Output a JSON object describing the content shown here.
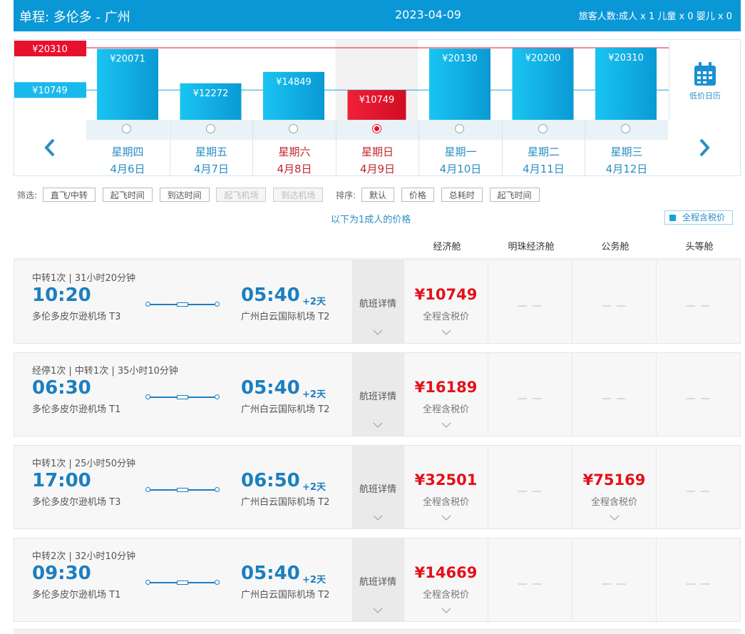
{
  "header": {
    "route": "单程:  多伦多  -  广州",
    "date": "2023-04-09",
    "passengers": "旅客人数:成人 x 1   儿童 x 0   婴儿 x 0"
  },
  "price_chart": {
    "max_label": "¥20310",
    "min_label": "¥10749",
    "max_value": 20310,
    "min_value": 10749,
    "calendar_label": "低价日历",
    "calendar_icon": "calendar-icon",
    "prev_icon": "chevron-left-icon",
    "next_icon": "chevron-right-icon",
    "days": [
      {
        "price": "¥20071",
        "value": 20071,
        "weekday": "星期四",
        "date": "4月6日",
        "weekend": false,
        "selected": false
      },
      {
        "price": "¥12272",
        "value": 12272,
        "weekday": "星期五",
        "date": "4月7日",
        "weekend": false,
        "selected": false
      },
      {
        "price": "¥14849",
        "value": 14849,
        "weekday": "星期六",
        "date": "4月8日",
        "weekend": true,
        "selected": false
      },
      {
        "price": "¥10749",
        "value": 10749,
        "weekday": "星期日",
        "date": "4月9日",
        "weekend": true,
        "selected": true
      },
      {
        "price": "¥20130",
        "value": 20130,
        "weekday": "星期一",
        "date": "4月10日",
        "weekend": false,
        "selected": false
      },
      {
        "price": "¥20200",
        "value": 20200,
        "weekday": "星期二",
        "date": "4月11日",
        "weekend": false,
        "selected": false
      },
      {
        "price": "¥20310",
        "value": 20310,
        "weekday": "星期三",
        "date": "4月12日",
        "weekend": false,
        "selected": false
      }
    ],
    "colors": {
      "bar": "#0fb7ea",
      "selected": "#e8112d",
      "max_line": "#e8112d",
      "min_line": "#1fa3d9"
    }
  },
  "filters": {
    "filter_label": "筛选:",
    "filter_buttons": [
      "直飞/中转",
      "起飞时间",
      "到达时间",
      "起飞机场",
      "到达机场"
    ],
    "sort_label": "排序:",
    "sort_buttons": [
      "默认",
      "价格",
      "总耗时",
      "起飞时间"
    ]
  },
  "price_note": "以下为1成人的价格",
  "tax_toggle": "全程含税价",
  "cabins": [
    "经济舱",
    "明珠经济舱",
    "公务舱",
    "头等舱"
  ],
  "flights": [
    {
      "meta": "中转1次 | 31小时20分钟",
      "dep_time": "10:20",
      "dep_airport": "多伦多皮尔逊机场 T3",
      "arr_time": "05:40",
      "plus_days": "+2天",
      "arr_airport": "广州白云国际机场 T2",
      "detail": "航班详情",
      "fares": [
        {
          "price": "¥10749",
          "tax": "全程含税价"
        },
        {
          "price": "",
          "tax": ""
        },
        {
          "price": "",
          "tax": ""
        },
        {
          "price": "",
          "tax": ""
        }
      ]
    },
    {
      "meta": "经停1次 | 中转1次 | 35小时10分钟",
      "dep_time": "06:30",
      "dep_airport": "多伦多皮尔逊机场 T1",
      "arr_time": "05:40",
      "plus_days": "+2天",
      "arr_airport": "广州白云国际机场 T2",
      "detail": "航班详情",
      "fares": [
        {
          "price": "¥16189",
          "tax": "全程含税价"
        },
        {
          "price": "",
          "tax": ""
        },
        {
          "price": "",
          "tax": ""
        },
        {
          "price": "",
          "tax": ""
        }
      ]
    },
    {
      "meta": "中转1次 | 25小时50分钟",
      "dep_time": "17:00",
      "dep_airport": "多伦多皮尔逊机场 T3",
      "arr_time": "06:50",
      "plus_days": "+2天",
      "arr_airport": "广州白云国际机场 T2",
      "detail": "航班详情",
      "fares": [
        {
          "price": "¥32501",
          "tax": "全程含税价"
        },
        {
          "price": "",
          "tax": ""
        },
        {
          "price": "¥75169",
          "tax": "全程含税价"
        },
        {
          "price": "",
          "tax": ""
        }
      ]
    },
    {
      "meta": "中转2次 | 32小时10分钟",
      "dep_time": "09:30",
      "dep_airport": "多伦多皮尔逊机场 T1",
      "arr_time": "05:40",
      "plus_days": "+2天",
      "arr_airport": "广州白云国际机场 T2",
      "detail": "航班详情",
      "fares": [
        {
          "price": "¥14669",
          "tax": "全程含税价"
        },
        {
          "price": "",
          "tax": ""
        },
        {
          "price": "",
          "tax": ""
        },
        {
          "price": "",
          "tax": ""
        }
      ]
    }
  ],
  "empty_fare": "— —"
}
